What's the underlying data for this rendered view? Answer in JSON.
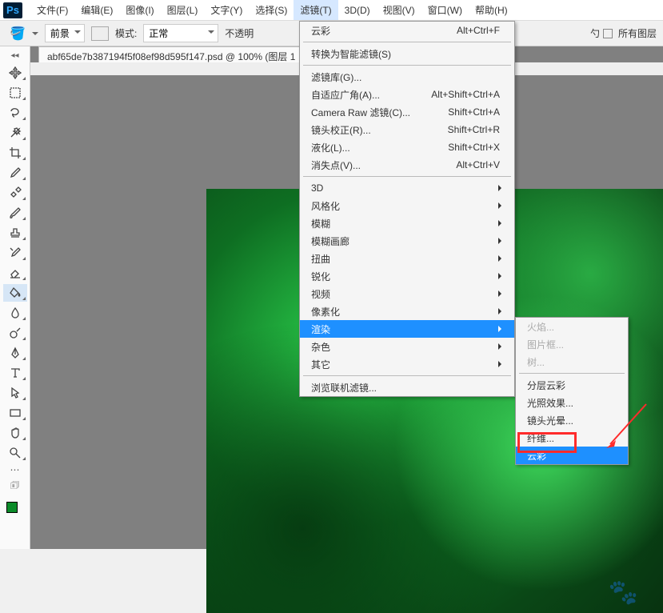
{
  "app": "Ps",
  "menubar": [
    "文件(F)",
    "编辑(E)",
    "图像(I)",
    "图层(L)",
    "文字(Y)",
    "选择(S)",
    "滤镜(T)",
    "3D(D)",
    "视图(V)",
    "窗口(W)",
    "帮助(H)"
  ],
  "menubar_open_index": 6,
  "options": {
    "foreground_label": "前景",
    "mode_label": "模式:",
    "mode_value": "正常",
    "opacity_label": "不透明",
    "all_layers_label": "所有图层"
  },
  "doc_tab": "abf65de7b387194f5f08ef98d595f147.psd @ 100% (图层 1",
  "tools": [
    {
      "name": "move"
    },
    {
      "name": "marquee"
    },
    {
      "name": "lasso"
    },
    {
      "name": "wand"
    },
    {
      "name": "crop"
    },
    {
      "name": "eyedropper"
    },
    {
      "name": "healing"
    },
    {
      "name": "brush"
    },
    {
      "name": "stamp"
    },
    {
      "name": "history-brush"
    },
    {
      "name": "eraser"
    },
    {
      "name": "bucket",
      "active": true
    },
    {
      "name": "blur"
    },
    {
      "name": "dodge"
    },
    {
      "name": "pen"
    },
    {
      "name": "text"
    },
    {
      "name": "path-select"
    },
    {
      "name": "rectangle"
    },
    {
      "name": "hand"
    },
    {
      "name": "zoom"
    }
  ],
  "filter_menu": {
    "last": {
      "label": "云彩",
      "shortcut": "Alt+Ctrl+F"
    },
    "convert": "转换为智能滤镜(S)",
    "gallery": "滤镜库(G)...",
    "wide_angle": {
      "label": "自适应广角(A)...",
      "shortcut": "Alt+Shift+Ctrl+A"
    },
    "camera_raw": {
      "label": "Camera Raw 滤镜(C)...",
      "shortcut": "Shift+Ctrl+A"
    },
    "lens": {
      "label": "镜头校正(R)...",
      "shortcut": "Shift+Ctrl+R"
    },
    "liquify": {
      "label": "液化(L)...",
      "shortcut": "Shift+Ctrl+X"
    },
    "vanishing": {
      "label": "消失点(V)...",
      "shortcut": "Alt+Ctrl+V"
    },
    "subs": [
      "3D",
      "风格化",
      "模糊",
      "模糊画廊",
      "扭曲",
      "锐化",
      "视频",
      "像素化",
      "渲染",
      "杂色",
      "其它"
    ],
    "subs_hi_index": 8,
    "browse": "浏览联机滤镜..."
  },
  "render_submenu": {
    "disabled": [
      "火焰...",
      "图片框...",
      "树..."
    ],
    "items": [
      "分层云彩",
      "光照效果...",
      "镜头光晕...",
      "纤维..."
    ],
    "highlighted": "云彩"
  }
}
